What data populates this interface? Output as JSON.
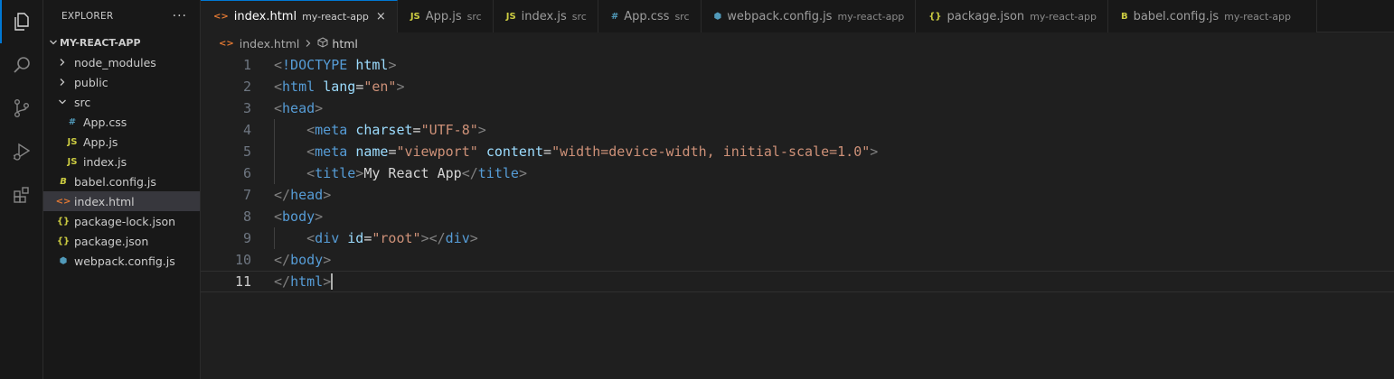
{
  "activity_bar": [
    "explorer-icon",
    "search-icon",
    "source-control-icon",
    "run-debug-icon",
    "extensions-icon"
  ],
  "explorer": {
    "title": "EXPLORER",
    "more": "···",
    "project": "MY-REACT-APP",
    "items": [
      {
        "label": "node_modules",
        "type": "folder",
        "depth": 1,
        "open": false
      },
      {
        "label": "public",
        "type": "folder",
        "depth": 1,
        "open": false
      },
      {
        "label": "src",
        "type": "folder",
        "depth": 1,
        "open": true
      },
      {
        "label": "App.css",
        "type": "css",
        "depth": 2,
        "icon": "#",
        "color": "#519aba"
      },
      {
        "label": "App.js",
        "type": "js",
        "depth": 2,
        "icon": "JS",
        "color": "#cbcb41"
      },
      {
        "label": "index.js",
        "type": "js",
        "depth": 2,
        "icon": "JS",
        "color": "#cbcb41"
      },
      {
        "label": "babel.config.js",
        "type": "babel",
        "depth": 1,
        "icon": "B",
        "color": "#cbcb41"
      },
      {
        "label": "index.html",
        "type": "html",
        "depth": 1,
        "icon": "<>",
        "color": "#e37933",
        "selected": true
      },
      {
        "label": "package-lock.json",
        "type": "json",
        "depth": 1,
        "icon": "{}",
        "color": "#cbcb41"
      },
      {
        "label": "package.json",
        "type": "json",
        "depth": 1,
        "icon": "{}",
        "color": "#cbcb41"
      },
      {
        "label": "webpack.config.js",
        "type": "webpack",
        "depth": 1,
        "icon": "⬢",
        "color": "#519aba"
      }
    ]
  },
  "tabs": [
    {
      "label": "index.html",
      "desc": "my-react-app",
      "icon": "<>",
      "color": "#e37933",
      "active": true,
      "close": "×"
    },
    {
      "label": "App.js",
      "desc": "src",
      "icon": "JS",
      "color": "#cbcb41"
    },
    {
      "label": "index.js",
      "desc": "src",
      "icon": "JS",
      "color": "#cbcb41"
    },
    {
      "label": "App.css",
      "desc": "src",
      "icon": "#",
      "color": "#519aba"
    },
    {
      "label": "webpack.config.js",
      "desc": "my-react-app",
      "icon": "⬢",
      "color": "#519aba"
    },
    {
      "label": "package.json",
      "desc": "my-react-app",
      "icon": "{}",
      "color": "#cbcb41"
    },
    {
      "label": "babel.config.js",
      "desc": "my-react-app",
      "icon": "B",
      "color": "#cbcb41"
    }
  ],
  "breadcrumb": {
    "file": "index.html",
    "symbol": "html"
  },
  "editor": {
    "current_line": 11,
    "lines": [
      [
        [
          "br",
          "<"
        ],
        [
          "tag",
          "!DOCTYPE"
        ],
        [
          "txt",
          " "
        ],
        [
          "attr",
          "html"
        ],
        [
          "br",
          ">"
        ]
      ],
      [
        [
          "br",
          "<"
        ],
        [
          "tag",
          "html"
        ],
        [
          "txt",
          " "
        ],
        [
          "attr",
          "lang"
        ],
        [
          "txt",
          "="
        ],
        [
          "str",
          "\"en\""
        ],
        [
          "br",
          ">"
        ]
      ],
      [
        [
          "br",
          "<"
        ],
        [
          "tag",
          "head"
        ],
        [
          "br",
          ">"
        ]
      ],
      [
        [
          "txt",
          "    "
        ],
        [
          "br",
          "<"
        ],
        [
          "tag",
          "meta"
        ],
        [
          "txt",
          " "
        ],
        [
          "attr",
          "charset"
        ],
        [
          "txt",
          "="
        ],
        [
          "str",
          "\"UTF-8\""
        ],
        [
          "br",
          ">"
        ]
      ],
      [
        [
          "txt",
          "    "
        ],
        [
          "br",
          "<"
        ],
        [
          "tag",
          "meta"
        ],
        [
          "txt",
          " "
        ],
        [
          "attr",
          "name"
        ],
        [
          "txt",
          "="
        ],
        [
          "str",
          "\"viewport\""
        ],
        [
          "txt",
          " "
        ],
        [
          "attr",
          "content"
        ],
        [
          "txt",
          "="
        ],
        [
          "str",
          "\"width=device-width, initial-scale=1.0\""
        ],
        [
          "br",
          ">"
        ]
      ],
      [
        [
          "txt",
          "    "
        ],
        [
          "br",
          "<"
        ],
        [
          "tag",
          "title"
        ],
        [
          "br",
          ">"
        ],
        [
          "txt",
          "My React App"
        ],
        [
          "br",
          "</"
        ],
        [
          "tag",
          "title"
        ],
        [
          "br",
          ">"
        ]
      ],
      [
        [
          "br",
          "</"
        ],
        [
          "tag",
          "head"
        ],
        [
          "br",
          ">"
        ]
      ],
      [
        [
          "br",
          "<"
        ],
        [
          "tag",
          "body"
        ],
        [
          "br",
          ">"
        ]
      ],
      [
        [
          "txt",
          "    "
        ],
        [
          "br",
          "<"
        ],
        [
          "tag",
          "div"
        ],
        [
          "txt",
          " "
        ],
        [
          "attr",
          "id"
        ],
        [
          "txt",
          "="
        ],
        [
          "str",
          "\"root\""
        ],
        [
          "br",
          "></"
        ],
        [
          "tag",
          "div"
        ],
        [
          "br",
          ">"
        ]
      ],
      [
        [
          "br",
          "</"
        ],
        [
          "tag",
          "body"
        ],
        [
          "br",
          ">"
        ]
      ],
      [
        [
          "br",
          "</"
        ],
        [
          "tag",
          "html"
        ],
        [
          "br",
          ">"
        ]
      ]
    ]
  }
}
